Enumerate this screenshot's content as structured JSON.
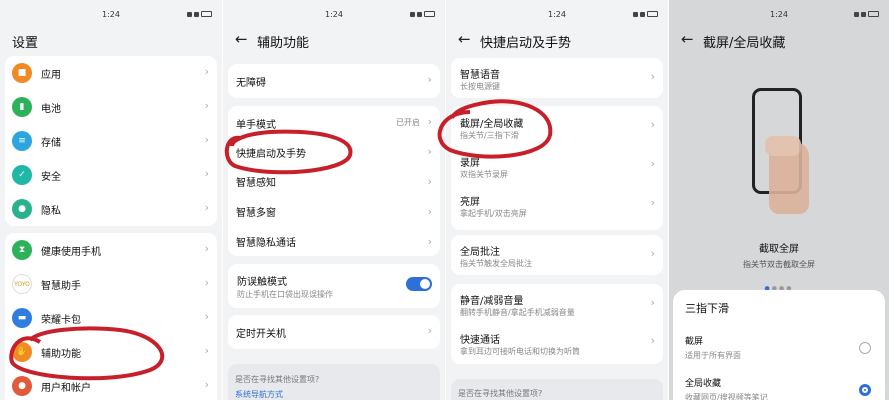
{
  "status": {
    "time": "1:24"
  },
  "panel1": {
    "title": "设置",
    "group1": [
      "应用",
      "电池",
      "存储",
      "安全",
      "隐私"
    ],
    "group2": [
      "健康使用手机",
      "智慧助手",
      "荣耀卡包",
      "辅助功能",
      "用户和帐户"
    ]
  },
  "panel2": {
    "title": "辅助功能",
    "item_accessibility": "无障碍",
    "one_hand": "单手模式",
    "one_hand_value": "已开启",
    "shortcuts": "快捷启动及手势",
    "smart_sense": "智慧感知",
    "smart_multiwindow": "智慧多窗",
    "smart_private_call": "智慧隐私通话",
    "anti_touch": "防误触模式",
    "anti_touch_sub": "防止手机在口袋出现误操作",
    "timer": "定时开关机",
    "hint_q": "是否在寻找其他设置项?",
    "hint_link": "系统导航方式"
  },
  "panel3": {
    "title": "快捷启动及手势",
    "items": [
      {
        "label": "智慧语音",
        "sub": "长按电源键"
      },
      {
        "label": "截屏/全局收藏",
        "sub": "指关节/三指下滑"
      },
      {
        "label": "录屏",
        "sub": "双指关节录屏"
      },
      {
        "label": "亮屏",
        "sub": "拿起手机/双击亮屏"
      },
      {
        "label": "全局批注",
        "sub": "指关节触发全局批注"
      },
      {
        "label": "静音/减弱音量",
        "sub": "翻转手机静音/拿起手机减弱音量"
      },
      {
        "label": "快速通话",
        "sub": "拿到耳边可接听电话和切换为听筒"
      }
    ],
    "hint_q": "是否在寻找其他设置项?"
  },
  "panel4": {
    "title": "截屏/全局收藏",
    "caption": "截取全屏",
    "caption_sub": "指关节双击截取全屏",
    "sheet_title": "三指下滑",
    "options": [
      {
        "label": "截屏",
        "sub": "适用于所有界面",
        "selected": false
      },
      {
        "label": "全局收藏",
        "sub": "收藏网页/搜视频等笔记",
        "selected": true
      }
    ]
  },
  "colors": {
    "accent": "#2f6fd8",
    "annotation": "#c8202a"
  }
}
